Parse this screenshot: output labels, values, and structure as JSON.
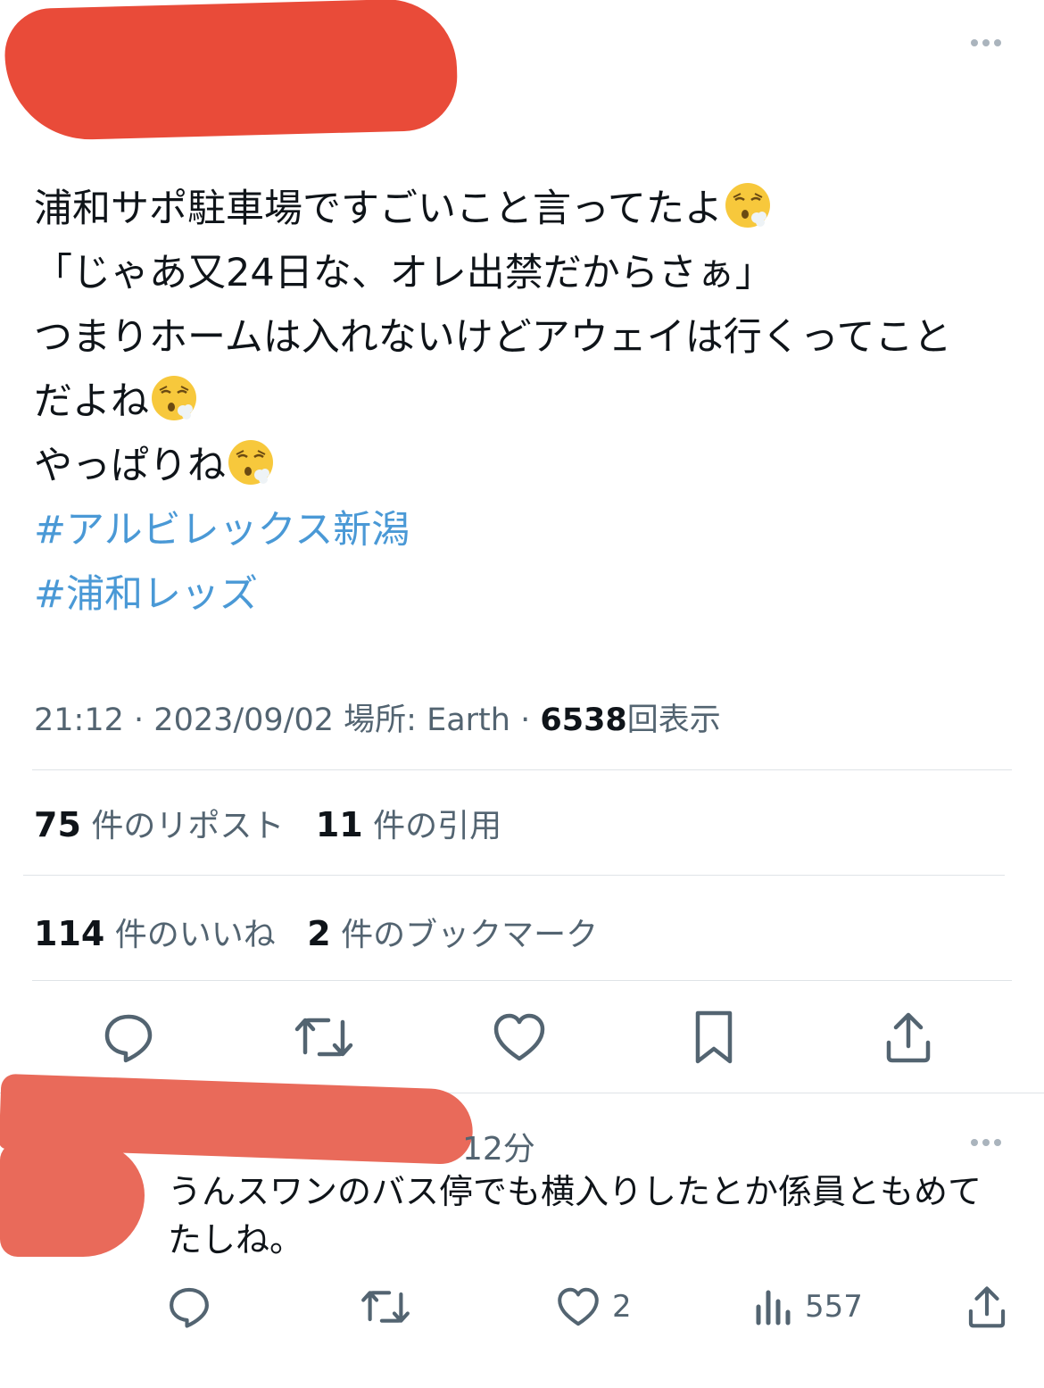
{
  "tweet": {
    "text_lines": [
      "浦和サポ駐車場ですごいこと言ってたよ",
      "「じゃあ又24日な、オレ出禁だからさぁ」",
      "つまりホームは入れないけどアウェイは行くってこと",
      "だよね",
      "やっぱりね"
    ],
    "hashtags": [
      "#アルビレックス新潟",
      "#浦和レッズ"
    ],
    "emoji_name": "face-exhaling-emoji",
    "time": "21:12",
    "date": "2023/09/02",
    "location_label": "場所: Earth",
    "views_count": "6538",
    "views_label": "回表示",
    "separator": "·"
  },
  "stats": {
    "reposts_count": "75",
    "reposts_label": "件のリポスト",
    "quotes_count": "11",
    "quotes_label": "件の引用",
    "likes_count": "114",
    "likes_label": "件のいいね",
    "bookmarks_count": "2",
    "bookmarks_label": "件のブックマーク"
  },
  "actions": [
    "reply-icon",
    "repost-icon",
    "like-icon",
    "bookmark-icon",
    "share-icon"
  ],
  "reply": {
    "time": "12分",
    "text_lines": [
      "うんスワンのバス停でも横入りしたとか係員ともめて",
      "たしね。"
    ],
    "likes_count": "2",
    "views_count": "557"
  },
  "colors": {
    "hashtag": "#4a99d6",
    "secondary_text": "#536471",
    "redaction": "#e8412e",
    "icon": "#536471"
  }
}
